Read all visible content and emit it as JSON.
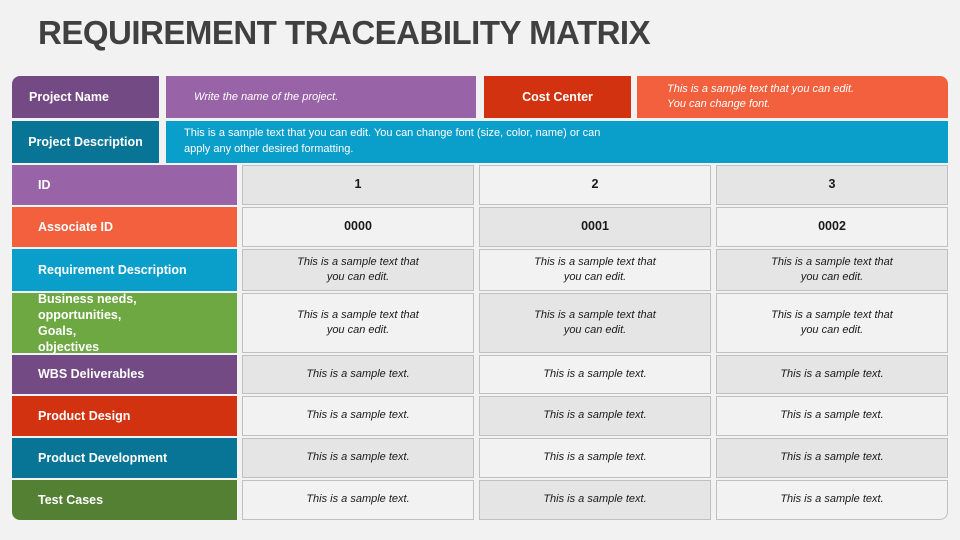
{
  "title": "REQUIREMENT TRACEABILITY MATRIX",
  "header": {
    "project_name_label": "Project Name",
    "project_name_value": "Write the name of the project.",
    "cost_center_label": "Cost Center",
    "cost_center_value": "This is a sample text that you can edit. You can change font.",
    "project_description_label": "Project Description",
    "project_description_value": "This is a sample text that you can edit. You can change font (size, color, name) or can apply any other desired formatting."
  },
  "colors": {
    "purple_dark": "#744a85",
    "purple_light": "#9963a8",
    "red_dark": "#d23210",
    "orange": "#f2603e",
    "teal_dark": "#087597",
    "cyan": "#0a9ecb",
    "green_light": "#6ea843",
    "green_dark": "#548033"
  },
  "matrix": {
    "rows": [
      {
        "label": "ID",
        "cells": [
          "1",
          "2",
          "3"
        ]
      },
      {
        "label": "Associate ID",
        "cells": [
          "0000",
          "0001",
          "0002"
        ]
      },
      {
        "label": "Requirement Description",
        "cells": [
          "This is a sample text that you can edit.",
          "This is a sample text that you can edit.",
          "This is a sample text that you can edit."
        ]
      },
      {
        "label": "Business needs, opportunities, Goals, objectives",
        "cells": [
          "This is a sample text that you can edit.",
          "This is a sample text that you can edit.",
          "This is a sample text that you can edit."
        ]
      },
      {
        "label": "WBS Deliverables",
        "cells": [
          "This is a sample text.",
          "This is a sample text.",
          "This is a sample text."
        ]
      },
      {
        "label": "Product Design",
        "cells": [
          "This is a sample text.",
          "This is a sample text.",
          "This is a sample text."
        ]
      },
      {
        "label": "Product Development",
        "cells": [
          "This is a sample text.",
          "This is a sample text.",
          "This is a sample text."
        ]
      },
      {
        "label": "Test Cases",
        "cells": [
          "This is a sample text.",
          "This is a sample text.",
          "This is a sample text."
        ]
      }
    ]
  }
}
